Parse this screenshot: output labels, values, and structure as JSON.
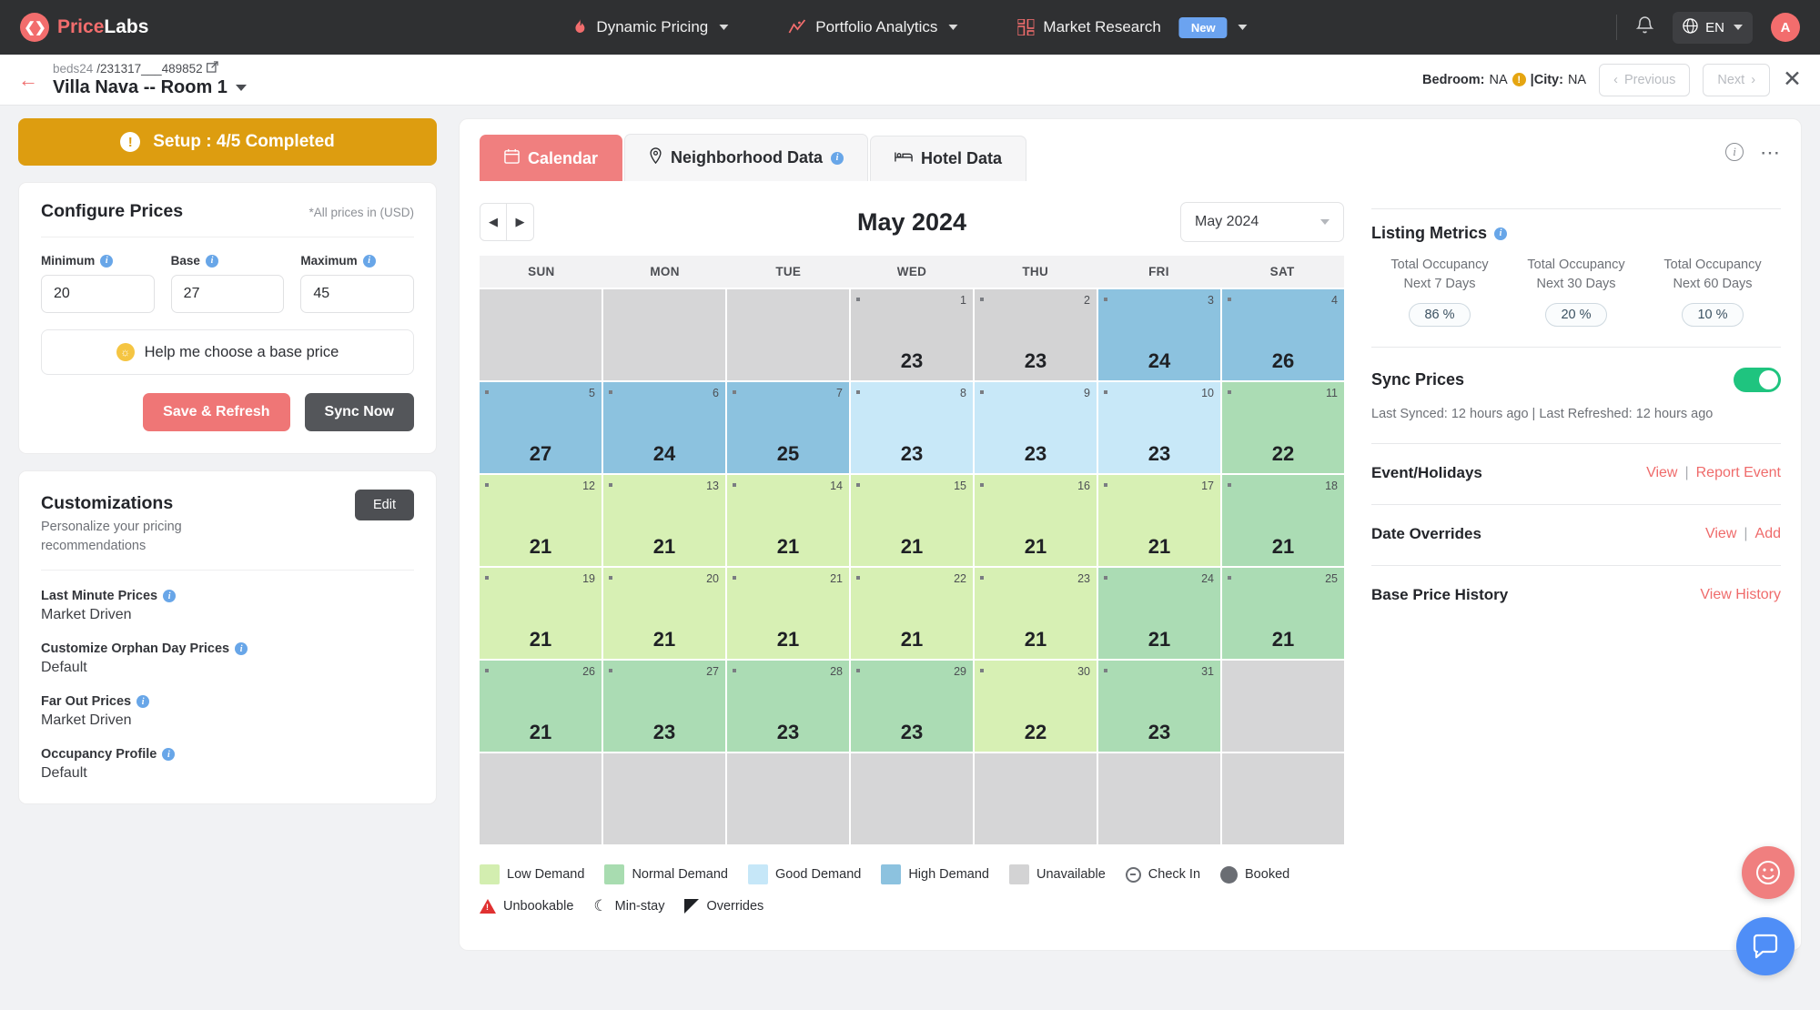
{
  "topnav": {
    "brand_a": "Price",
    "brand_b": "Labs",
    "brand_mark": "logo-icon",
    "items": [
      {
        "label": "Dynamic Pricing",
        "icon": "flame-icon",
        "caret": true
      },
      {
        "label": "Portfolio Analytics",
        "icon": "trend-chart-icon",
        "caret": true
      },
      {
        "label": "Market Research",
        "icon": "grid-icon",
        "badge": "New",
        "caret": true
      }
    ],
    "bell": "bell-icon",
    "language": "EN",
    "globe": "globe-icon",
    "avatar": "A"
  },
  "subheader": {
    "back": "back-arrow-icon",
    "breadcrumb_provider": "beds24",
    "breadcrumb_id": "/231317___489852",
    "external_link": "external-link-icon",
    "title": "Villa Nava -- Room 1",
    "bedroom_label": "Bedroom:",
    "bedroom_value": "NA",
    "city_label": "|City:",
    "city_value": "NA",
    "previous": "Previous",
    "next": "Next",
    "close": "✕"
  },
  "sidebar": {
    "setup_banner": "Setup : 4/5 Completed",
    "configure": {
      "title": "Configure Prices",
      "note": "*All prices in (USD)",
      "fields": [
        {
          "label": "Minimum",
          "value": "20"
        },
        {
          "label": "Base",
          "value": "27"
        },
        {
          "label": "Maximum",
          "value": "45"
        }
      ],
      "help_label": "Help me choose a base price",
      "save_label": "Save & Refresh",
      "sync_label": "Sync Now"
    },
    "customizations": {
      "title": "Customizations",
      "subtitle": "Personalize your pricing recommendations",
      "edit_label": "Edit",
      "items": [
        {
          "name": "Last Minute Prices",
          "value": "Market Driven"
        },
        {
          "name": "Customize Orphan Day Prices",
          "value": "Default"
        },
        {
          "name": "Far Out Prices",
          "value": "Market Driven"
        },
        {
          "name": "Occupancy Profile",
          "value": "Default"
        }
      ]
    }
  },
  "panel": {
    "tabs": [
      {
        "label": "Calendar",
        "icon": "calendar-icon",
        "active": true,
        "info": false
      },
      {
        "label": "Neighborhood Data",
        "icon": "map-pin-icon",
        "active": false,
        "info": true
      },
      {
        "label": "Hotel Data",
        "icon": "bed-icon",
        "active": false,
        "info": false
      }
    ],
    "info_icon": "info-icon",
    "more_icon": "more-options-icon"
  },
  "calendar": {
    "prev": "◀",
    "next": "▶",
    "month_title": "May 2024",
    "month_select": "May 2024",
    "dow": [
      "SUN",
      "MON",
      "TUE",
      "WED",
      "THU",
      "FRI",
      "SAT"
    ],
    "cells": [
      {
        "day": "",
        "price": "",
        "state": "empty"
      },
      {
        "day": "",
        "price": "",
        "state": "empty"
      },
      {
        "day": "",
        "price": "",
        "state": "empty"
      },
      {
        "day": "1",
        "price": "23",
        "state": "unavailable"
      },
      {
        "day": "2",
        "price": "23",
        "state": "unavailable"
      },
      {
        "day": "3",
        "price": "24",
        "state": "high"
      },
      {
        "day": "4",
        "price": "26",
        "state": "high"
      },
      {
        "day": "5",
        "price": "27",
        "state": "high"
      },
      {
        "day": "6",
        "price": "24",
        "state": "high"
      },
      {
        "day": "7",
        "price": "25",
        "state": "high"
      },
      {
        "day": "8",
        "price": "23",
        "state": "good"
      },
      {
        "day": "9",
        "price": "23",
        "state": "good"
      },
      {
        "day": "10",
        "price": "23",
        "state": "good"
      },
      {
        "day": "11",
        "price": "22",
        "state": "normal"
      },
      {
        "day": "12",
        "price": "21",
        "state": "low"
      },
      {
        "day": "13",
        "price": "21",
        "state": "low"
      },
      {
        "day": "14",
        "price": "21",
        "state": "low"
      },
      {
        "day": "15",
        "price": "21",
        "state": "low"
      },
      {
        "day": "16",
        "price": "21",
        "state": "low"
      },
      {
        "day": "17",
        "price": "21",
        "state": "low"
      },
      {
        "day": "18",
        "price": "21",
        "state": "normal"
      },
      {
        "day": "19",
        "price": "21",
        "state": "low"
      },
      {
        "day": "20",
        "price": "21",
        "state": "low"
      },
      {
        "day": "21",
        "price": "21",
        "state": "low"
      },
      {
        "day": "22",
        "price": "21",
        "state": "low"
      },
      {
        "day": "23",
        "price": "21",
        "state": "low"
      },
      {
        "day": "24",
        "price": "21",
        "state": "normal"
      },
      {
        "day": "25",
        "price": "21",
        "state": "normal"
      },
      {
        "day": "26",
        "price": "21",
        "state": "normal"
      },
      {
        "day": "27",
        "price": "23",
        "state": "normal"
      },
      {
        "day": "28",
        "price": "23",
        "state": "normal"
      },
      {
        "day": "29",
        "price": "23",
        "state": "normal"
      },
      {
        "day": "30",
        "price": "22",
        "state": "low"
      },
      {
        "day": "31",
        "price": "23",
        "state": "normal"
      },
      {
        "day": "",
        "price": "",
        "state": "empty"
      },
      {
        "day": "",
        "price": "",
        "state": "empty"
      },
      {
        "day": "",
        "price": "",
        "state": "empty"
      },
      {
        "day": "",
        "price": "",
        "state": "empty"
      },
      {
        "day": "",
        "price": "",
        "state": "empty"
      },
      {
        "day": "",
        "price": "",
        "state": "empty"
      },
      {
        "day": "",
        "price": "",
        "state": "empty"
      },
      {
        "day": "",
        "price": "",
        "state": "empty"
      }
    ]
  },
  "legend": {
    "row1": [
      {
        "label": "Low Demand",
        "type": "swatch",
        "color": "#d3eeb0"
      },
      {
        "label": "Normal Demand",
        "type": "swatch",
        "color": "#a8dcb0"
      },
      {
        "label": "Good Demand",
        "type": "swatch",
        "color": "#c6e7f8"
      },
      {
        "label": "High Demand",
        "type": "swatch",
        "color": "#8cc2df"
      },
      {
        "label": "Unavailable",
        "type": "swatch",
        "color": "#d3d3d4"
      },
      {
        "label": "Check In",
        "type": "checkin",
        "color": "#6a6d73"
      },
      {
        "label": "Booked",
        "type": "booked",
        "color": "#6a6d73"
      }
    ],
    "row2": [
      {
        "label": "Unbookable",
        "type": "warn",
        "color": "#e03131"
      },
      {
        "label": "Min-stay",
        "type": "moon",
        "color": "#2d2f34"
      },
      {
        "label": "Overrides",
        "type": "flag",
        "color": "#1f2125"
      }
    ]
  },
  "metrics": {
    "title": "Listing Metrics",
    "occupancy": [
      {
        "label_1": "Total Occupancy",
        "label_2": "Next 7 Days",
        "value": "86 %"
      },
      {
        "label_1": "Total Occupancy",
        "label_2": "Next 30 Days",
        "value": "20 %"
      },
      {
        "label_1": "Total Occupancy",
        "label_2": "Next 60 Days",
        "value": "10 %"
      }
    ],
    "sync_prices_label": "Sync Prices",
    "sync_enabled": true,
    "sync_note": "Last Synced: 12 hours ago | Last Refreshed: 12 hours ago",
    "links": [
      {
        "label": "Event/Holidays",
        "actions": [
          "View",
          "Report Event"
        ]
      },
      {
        "label": "Date Overrides",
        "actions": [
          "View",
          "Add"
        ]
      },
      {
        "label": "Base Price History",
        "actions": [
          "View History"
        ]
      }
    ]
  },
  "fabs": [
    {
      "name": "feedback-fab",
      "icon": "smile-icon",
      "color": "#f07f7f"
    },
    {
      "name": "chat-fab",
      "icon": "chat-icon",
      "color": "#4f8ef7"
    }
  ]
}
